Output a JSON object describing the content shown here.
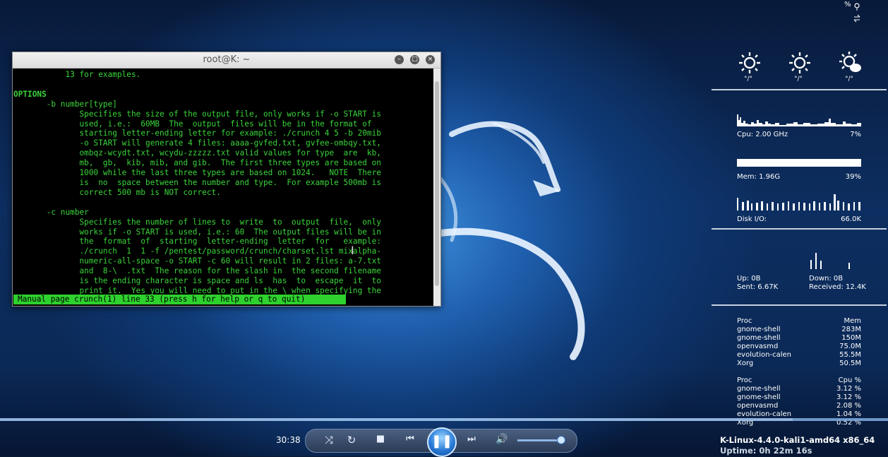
{
  "terminal": {
    "title": "root@K: ~",
    "lines": [
      "           13 for examples.",
      "",
      "OPTIONS",
      "       -b number[type]",
      "              Specifies the size of the output file, only works if -o START is",
      "              used, i.e.:  60MB  The  output  files will be in the format of",
      "              starting letter-ending letter for example: ./crunch 4 5 -b 20mib",
      "              -o START will generate 4 files: aaaa-gvfed.txt, gvfee-ombqy.txt,",
      "              ombqz-wcydt.txt, wcydu-zzzzz.txt valid values for type  are  kb,",
      "              mb,  gb,  kib, mib, and gib.  The first three types are based on",
      "              1000 while the last three types are based on 1024.   NOTE  There",
      "              is  no  space between the number and type.  For example 500mb is",
      "              correct 500 mb is NOT correct.",
      "",
      "       -c number",
      "              Specifies the number of lines to  write  to  output  file,  only",
      "              works if -o START is used, i.e.: 60  The output files will be in",
      "              the  format  of  starting  letter-ending  letter  for   example:",
      "              ./crunch  1  1 -f /pentest/password/crunch/charset.lst mixalpha-",
      "              numeric-all-space -o START -c 60 will result in 2 files: a-7.txt",
      "              and  8-\\  .txt  The reason for the slash in  the second filename",
      "              is the ending character is space and ls  has  to  escape  it  to",
      "              print it.  Yes you will need to put in the \\ when specifying the"
    ],
    "status": "Manual page crunch(1) line 33 (press h for help or q to quit)"
  },
  "conky": {
    "top_indicator": "%",
    "temps": [
      "°/°",
      "°/°",
      "°/°"
    ],
    "cpu_label": "Cpu: 2.00 GHz",
    "cpu_pct": "7%",
    "mem_label": "Mem: 1.96G",
    "mem_pct": "39%",
    "mem_fill": 0.39,
    "disk_label": "Disk I/O:",
    "disk_value": "66.0K",
    "up": "Up: 0B",
    "sent": "Sent: 6.67K",
    "down": "Down: 0B",
    "received": "Received: 12.4K",
    "mem_table": {
      "h1": "Proc",
      "h2": "Mem",
      "rows": [
        [
          "gnome-shell",
          "283M"
        ],
        [
          "gnome-shell",
          "150M"
        ],
        [
          "openvasmd",
          "75.0M"
        ],
        [
          "evolution-calen",
          "55.5M"
        ],
        [
          "Xorg",
          "50.5M"
        ]
      ]
    },
    "cpu_table": {
      "h1": "Proc",
      "h2": "Cpu %",
      "rows": [
        [
          "gnome-shell",
          "3.12 %"
        ],
        [
          "gnome-shell",
          "3.12 %"
        ],
        [
          "openvasmd",
          "2.08 %"
        ],
        [
          "evolution-calen",
          "1.04 %"
        ],
        [
          "Xorg",
          "0.52 %"
        ]
      ]
    },
    "kernel": "K-Linux-4.4.0-kali1-amd64 x86_64",
    "uptime": "Uptime: 0h 22m 16s"
  },
  "player": {
    "time": "30:38",
    "progress": 0.893,
    "volume": 0.85
  }
}
